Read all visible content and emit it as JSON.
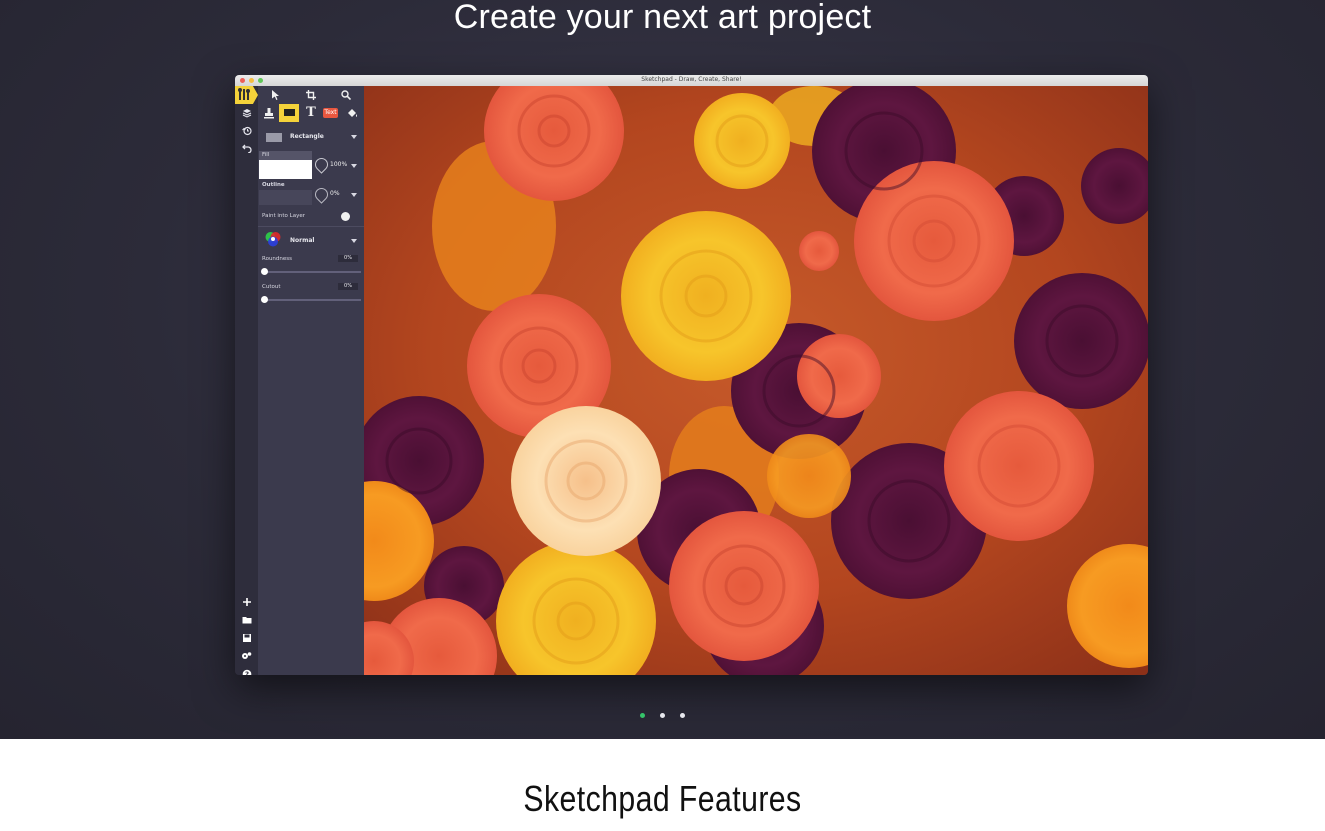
{
  "hero": {
    "title": "Create your next art project"
  },
  "window": {
    "title": "Sketchpad - Draw, Create, Share!",
    "traffic_light_colors": [
      "#ee5f57",
      "#f5be3f",
      "#5fc657"
    ]
  },
  "rail": {
    "icons": [
      "layers-icon",
      "history-icon",
      "undo-icon"
    ],
    "bottom_icons": [
      "add-icon",
      "folder-icon",
      "save-icon",
      "settings-icon",
      "help-icon"
    ]
  },
  "toolbar": {
    "row1": [
      "select-icon",
      "crop-icon",
      "zoom-icon"
    ],
    "row2": [
      "stamp-icon",
      "shape-icon",
      "text-icon",
      "text-badge-icon",
      "fill-bucket-icon"
    ],
    "text_badge": "Text",
    "accent": "#f4d23a"
  },
  "panel": {
    "shape": "Rectangle",
    "fill_label": "Fill",
    "fill_opacity": "100%",
    "outline_label": "Outline",
    "outline_opacity": "0%",
    "paint_into_layer": "Paint into Layer",
    "blend_mode": "Normal",
    "roundness_label": "Roundness",
    "roundness_value": "0%",
    "cutout_label": "Cutout",
    "cutout_value": "0%"
  },
  "carousel": {
    "count": 3,
    "active_index": 0,
    "active_color": "#35c46a"
  },
  "features": {
    "title": "Sketchpad Features"
  }
}
